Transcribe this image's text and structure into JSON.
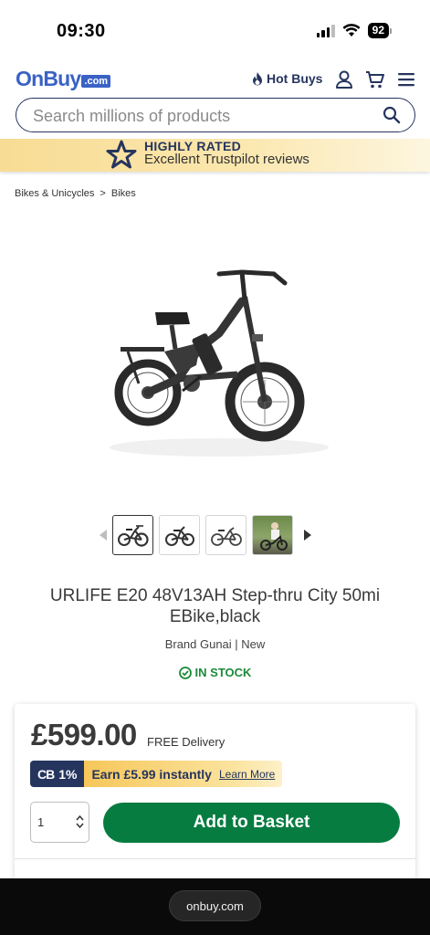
{
  "status_bar": {
    "time": "09:30",
    "battery": "92"
  },
  "header": {
    "logo_text": "OnBuy",
    "logo_suffix": ".com",
    "hot_buys_label": "Hot Buys"
  },
  "search": {
    "placeholder": "Search millions of products"
  },
  "trust_banner": {
    "title": "HIGHLY RATED",
    "subtitle": "Excellent Trustpilot reviews"
  },
  "breadcrumb": {
    "items": [
      "Bikes & Unicycles",
      "Bikes"
    ],
    "separator": ">"
  },
  "product": {
    "title": "URLIFE E20 48V13AH Step-thru City 50mi EBike,black",
    "meta": "Brand Gunai | New",
    "stock": "IN STOCK",
    "price": "£599.00",
    "delivery": "FREE Delivery",
    "cashback_percent": "1%",
    "cashback_mark": "CB",
    "cashback_text": "Earn £5.99 instantly",
    "cashback_link": "Learn More",
    "quantity": "1",
    "add_to_basket": "Add to Basket"
  },
  "browser": {
    "url": "onbuy.com"
  },
  "colors": {
    "brand_blue": "#3a62c5",
    "navy": "#26355e",
    "green": "#067c41",
    "stock_green": "#1c8a3a"
  }
}
